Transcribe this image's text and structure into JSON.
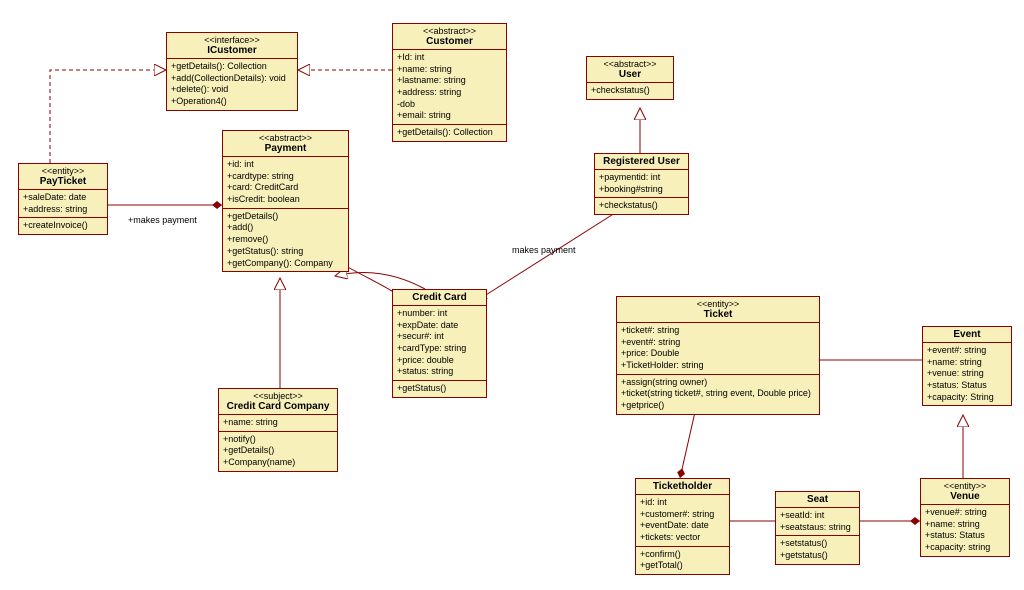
{
  "classes": {
    "icustomer": {
      "stereotype": "<<interface>>",
      "name": "ICustomer",
      "attrs": [],
      "ops": [
        "+getDetails(): Collection",
        "+add(CollectionDetails): void",
        "+delete(): void",
        "+Operation4()"
      ]
    },
    "customer": {
      "stereotype": "<<abstract>>",
      "name": "Customer",
      "attrs": [
        "+Id: int",
        "+name: string",
        "+lastname: string",
        "+address: string",
        "-dob",
        "+email: string"
      ],
      "ops": [
        "+getDetails(): Collection"
      ]
    },
    "user": {
      "stereotype": "<<abstract>>",
      "name": "User",
      "attrs": [],
      "ops": [
        "+checkstatus()"
      ]
    },
    "payticket": {
      "stereotype": "<<entity>>",
      "name": "PayTicket",
      "attrs": [
        "+saleDate: date",
        "+address: string"
      ],
      "ops": [
        "+createInvoice()"
      ]
    },
    "payment": {
      "stereotype": "<<abstract>>",
      "name": "Payment",
      "attrs": [
        "+id: int",
        "+cardtype: string",
        "+card: CreditCard",
        "+isCredit: boolean"
      ],
      "ops": [
        "+getDetails()",
        "+add()",
        "+remove()",
        "+getStatus(): string",
        "+getCompany(): Company"
      ]
    },
    "registereduser": {
      "stereotype": "",
      "name": "Registered User",
      "attrs": [
        "+paymentid: int",
        "+booking#string"
      ],
      "ops": [
        "+checkstatus()"
      ]
    },
    "creditcard": {
      "stereotype": "",
      "name": "Credit Card",
      "attrs": [
        "+number: int",
        "+expDate: date",
        "+secur#: int",
        "+cardType: string",
        "+price: double",
        "+status: string"
      ],
      "ops": [
        "+getStatus()"
      ]
    },
    "creditcardcompany": {
      "stereotype": "<<subject>>",
      "name": "Credit Card Company",
      "attrs": [
        "+name: string"
      ],
      "ops": [
        "+notify()",
        "+getDetails()",
        "+Company(name)"
      ]
    },
    "ticket": {
      "stereotype": "<<entity>>",
      "name": "Ticket",
      "attrs": [
        "+ticket#: string",
        "+event#: string",
        "+price: Double",
        "+TicketHolder: string"
      ],
      "ops": [
        "+assign(string owner)",
        "+ticket(string ticket#, string event, Double price)",
        "+getprice()"
      ]
    },
    "event": {
      "stereotype": "",
      "name": "Event",
      "attrs": [
        "+event#: string",
        "+name: string",
        "+venue: string",
        "+status: Status",
        "+capacity: String"
      ],
      "ops": []
    },
    "ticketholder": {
      "stereotype": "",
      "name": "Ticketholder",
      "attrs": [
        "+id: int",
        "+customer#: string",
        "+eventDate: date",
        "+tickets: vector"
      ],
      "ops": [
        "+confirm()",
        "+getTotal()"
      ]
    },
    "seat": {
      "stereotype": "",
      "name": "Seat",
      "attrs": [
        "+seatId: int",
        "+seatstaus: string"
      ],
      "ops": [
        "+setstatus()",
        "+getstatus()"
      ]
    },
    "venue": {
      "stereotype": "<<entity>>",
      "name": "Venue",
      "attrs": [
        "+venue#: string",
        "+name: string",
        "+status: Status",
        "+capacity: string"
      ],
      "ops": []
    }
  },
  "labels": {
    "makespayment1": "+makes payment",
    "makespayment2": "makes payment"
  }
}
